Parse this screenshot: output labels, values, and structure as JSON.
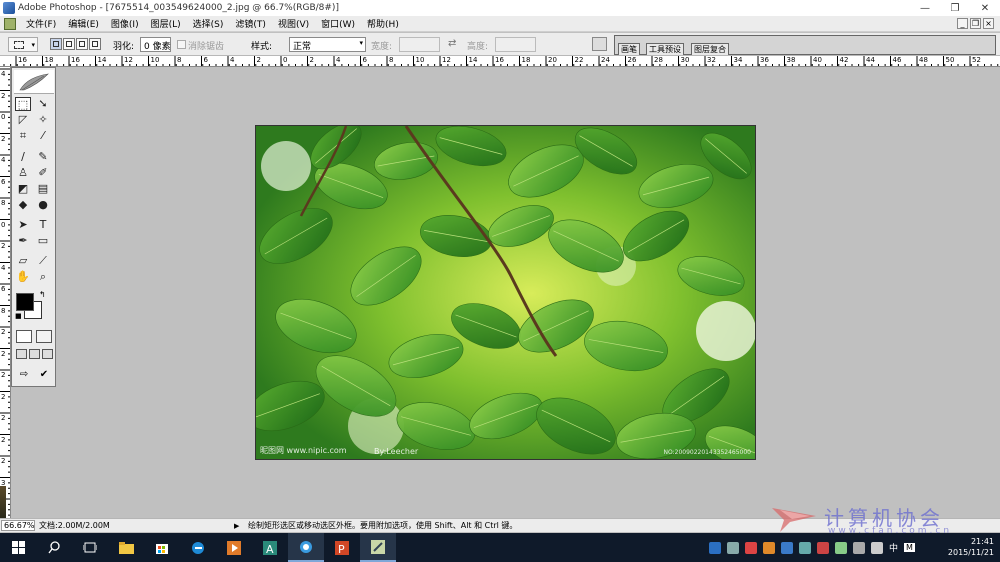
{
  "window": {
    "title": "Adobe Photoshop - [7675514_003549624000_2.jpg @ 66.7%(RGB/8#)]",
    "controls": [
      "—",
      "❐",
      "✕"
    ]
  },
  "menu": {
    "items": [
      "文件(F)",
      "编辑(E)",
      "图像(I)",
      "图层(L)",
      "选择(S)",
      "滤镜(T)",
      "视图(V)",
      "窗口(W)",
      "帮助(H)"
    ],
    "doc_controls": [
      "_",
      "❐",
      "×"
    ]
  },
  "options": {
    "feather_label": "羽化:",
    "feather_value": "0 像素",
    "antialias_label": "消除锯齿",
    "style_label": "样式:",
    "style_value": "正常",
    "width_label": "宽度:",
    "height_label": "高度:",
    "palette_tabs": [
      "画笔",
      "工具预设",
      "图层复合"
    ]
  },
  "rulers": {
    "horizontal": [
      "16",
      "18",
      "16",
      "14",
      "12",
      "10",
      "8",
      "6",
      "4",
      "2",
      "0",
      "2",
      "4",
      "6",
      "8",
      "10",
      "12",
      "14",
      "16",
      "18",
      "20",
      "22",
      "24",
      "26",
      "28",
      "30",
      "32",
      "34",
      "36",
      "38",
      "40",
      "42",
      "44",
      "46",
      "48",
      "50",
      "52"
    ],
    "vertical": [
      "4",
      "2",
      "0",
      "2",
      "4",
      "6",
      "8",
      "0",
      "2",
      "4",
      "6",
      "8",
      "2",
      "2",
      "2",
      "2",
      "2",
      "2",
      "2",
      "3",
      "3"
    ]
  },
  "canvas": {
    "watermark_left": "昵图网 www.nipic.com",
    "watermark_mid": "By:Leecher",
    "watermark_right": "NO:20090220143352465000"
  },
  "status": {
    "zoom": "66.67%",
    "doc_size": "文档:2.00M/2.00M",
    "hint": "绘制矩形选区或移动选区外框。要用附加选项，使用 Shift、Alt 和 Ctrl 键。"
  },
  "site_watermark": {
    "chinese": "计算机协会",
    "url": "www.cfan.com.cn"
  },
  "taskbar": {
    "time": "21:41",
    "date": "2015/11/21",
    "ime": "中",
    "ime2": "M"
  }
}
